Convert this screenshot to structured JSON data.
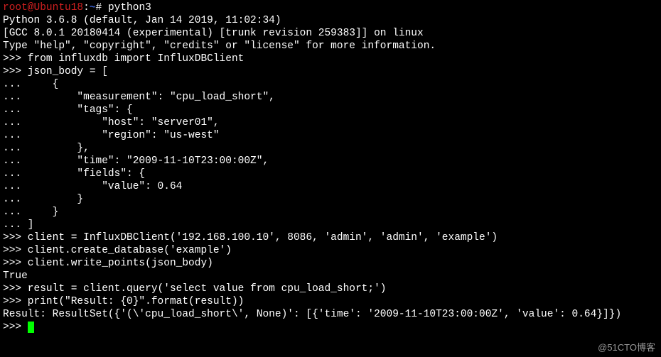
{
  "prompt_user": "root@Ubuntu18",
  "prompt_sep1": ":",
  "prompt_path": "~",
  "prompt_sep2": "# ",
  "cmd": "python3",
  "banner1": "Python 3.6.8 (default, Jan 14 2019, 11:02:34) ",
  "banner2": "[GCC 8.0.1 20180414 (experimental) [trunk revision 259383]] on linux",
  "banner3": "Type \"help\", \"copyright\", \"credits\" or \"license\" for more information.",
  "l1": ">>> from influxdb import InfluxDBClient",
  "l2": ">>> json_body = [",
  "l3": "...     {",
  "l4": "...         \"measurement\": \"cpu_load_short\",",
  "l5": "...         \"tags\": {",
  "l6": "...             \"host\": \"server01\",",
  "l7": "...             \"region\": \"us-west\"",
  "l8": "...         },",
  "l9": "...         \"time\": \"2009-11-10T23:00:00Z\",",
  "l10": "...         \"fields\": {",
  "l11": "...             \"value\": 0.64",
  "l12": "...         }",
  "l13": "...     }",
  "l14": "... ]",
  "l15": ">>> client = InfluxDBClient('192.168.100.10', 8086, 'admin', 'admin', 'example')",
  "l16": ">>> client.create_database('example')",
  "l17": ">>> client.write_points(json_body)",
  "l18": "True",
  "l19": ">>> result = client.query('select value from cpu_load_short;')",
  "l20": ">>> print(\"Result: {0}\".format(result))",
  "l21": "Result: ResultSet({'(\\'cpu_load_short\\', None)': [{'time': '2009-11-10T23:00:00Z', 'value': 0.64}]})",
  "l22": ">>> ",
  "watermark": "@51CTO博客"
}
